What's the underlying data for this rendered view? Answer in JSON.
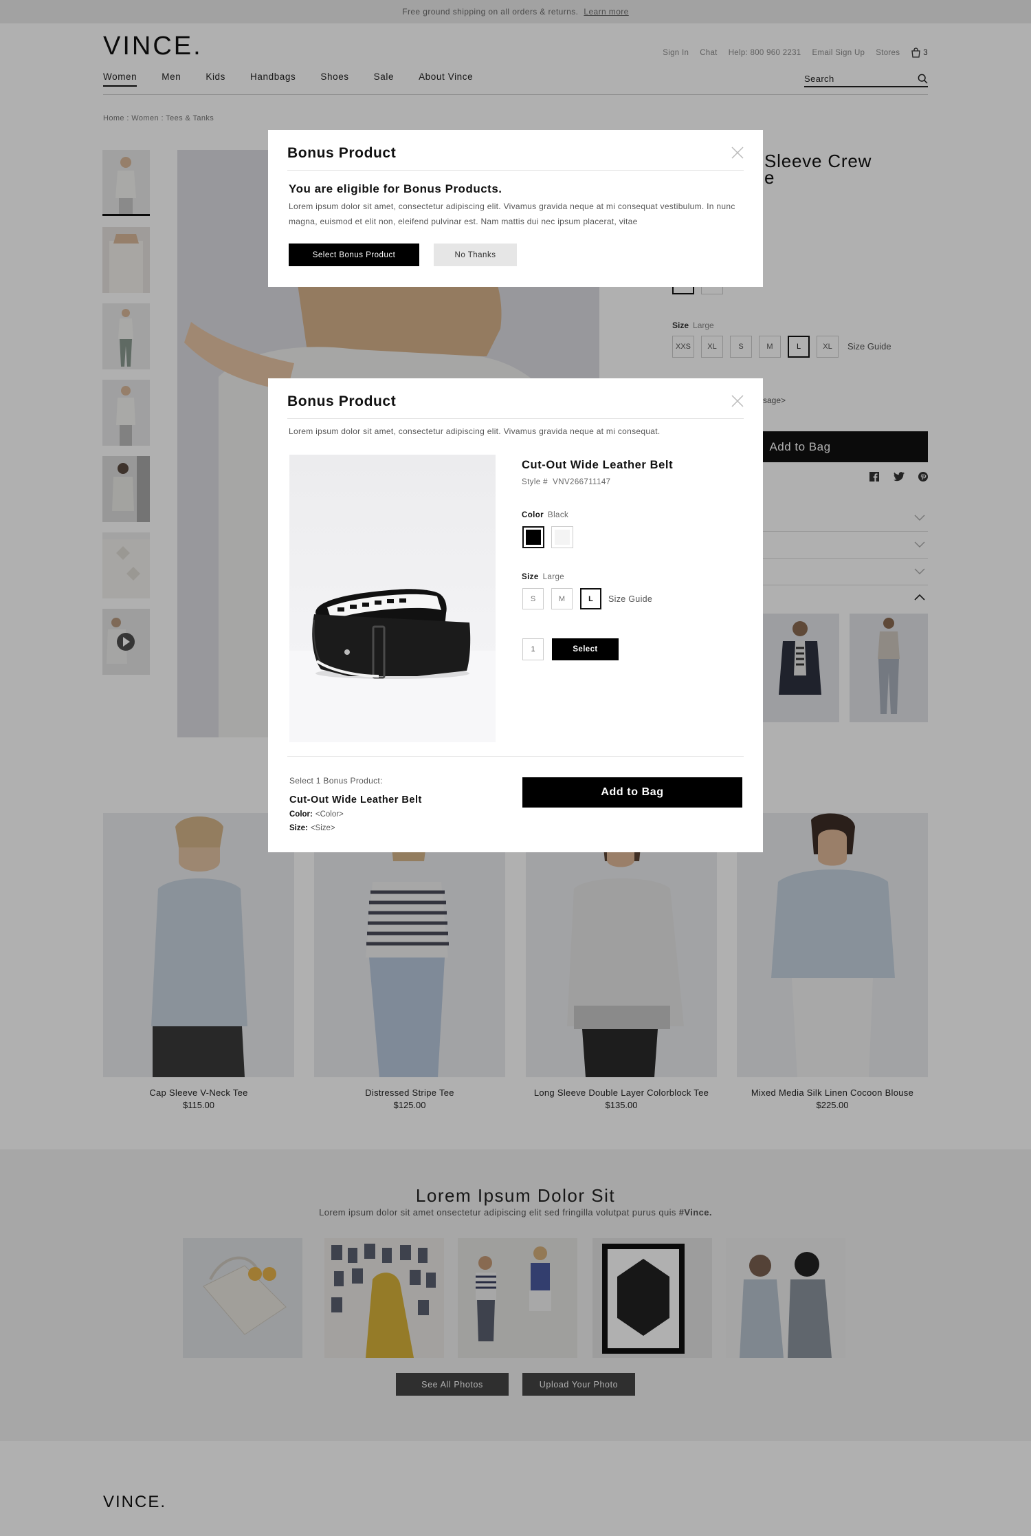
{
  "promo": {
    "text": "Free ground shipping on all orders & returns.",
    "link": "Learn more"
  },
  "header": {
    "logo": "VINCE.",
    "utility": [
      "Sign In",
      "Chat",
      "Help: 800 960 2231",
      "Email Sign Up",
      "Stores"
    ],
    "bag_count": "3",
    "nav": [
      "Women",
      "Men",
      "Kids",
      "Handbags",
      "Shoes",
      "Sale",
      "About Vince"
    ],
    "search_label": "Search"
  },
  "breadcrumb": "Home : Women : Tees & Tanks",
  "product": {
    "title_line1": "Sleeve Crew",
    "title_line2": "e",
    "size_label": "Size",
    "size_value": "Large",
    "sizes": [
      "XXS",
      "XL",
      "S",
      "M",
      "L",
      "XL"
    ],
    "size_guide": "Size Guide",
    "msg_fragment": "sage>",
    "add_to_bag": "Add to Bag"
  },
  "related": [
    {
      "name": "Cap Sleeve V-Neck Tee",
      "price": "$115.00"
    },
    {
      "name": "Distressed Stripe Tee",
      "price": "$125.00"
    },
    {
      "name": "Long Sleeve Double Layer Colorblock Tee",
      "price": "$135.00"
    },
    {
      "name": "Mixed Media Silk Linen Cocoon Blouse",
      "price": "$225.00"
    }
  ],
  "community": {
    "title": "Lorem Ipsum Dolor Sit",
    "subtitle": "Lorem ipsum dolor sit amet onsectetur adipiscing elit sed fringilla volutpat purus quis",
    "hashtag": "#Vince.",
    "see_all": "See All Photos",
    "upload": "Upload Your Photo"
  },
  "footer": {
    "logo": "VINCE."
  },
  "modal1": {
    "title": "Bonus Product",
    "heading": "You are eligible for Bonus Products.",
    "body": "Lorem ipsum dolor sit amet, consectetur adipiscing elit. Vivamus gravida neque at mi consequat vestibulum. In nunc magna, euismod et elit non, eleifend pulvinar est. Nam mattis dui nec ipsum placerat, vitae",
    "select_button": "Select Bonus Product",
    "no_thanks_button": "No Thanks"
  },
  "modal2": {
    "title": "Bonus Product",
    "description": "Lorem ipsum dolor sit amet, consectetur adipiscing elit. Vivamus gravida neque at mi consequat.",
    "product_name": "Cut-Out Wide Leather Belt",
    "style_label": "Style #",
    "style_number": "VNV266711147",
    "color_label": "Color",
    "color_value": "Black",
    "swatch_colors": [
      "#000000",
      "#f4f4f4"
    ],
    "size_label": "Size",
    "size_value": "Large",
    "sizes": [
      "S",
      "M",
      "L"
    ],
    "size_guide": "Size Guide",
    "quantity": "1",
    "select_button": "Select",
    "summary_title": "Select 1 Bonus Product:",
    "summary_name": "Cut-Out Wide Leather Belt",
    "summary_color_label": "Color:",
    "summary_color_value": "<Color>",
    "summary_size_label": "Size:",
    "summary_size_value": "<Size>",
    "add_to_bag": "Add to Bag"
  }
}
